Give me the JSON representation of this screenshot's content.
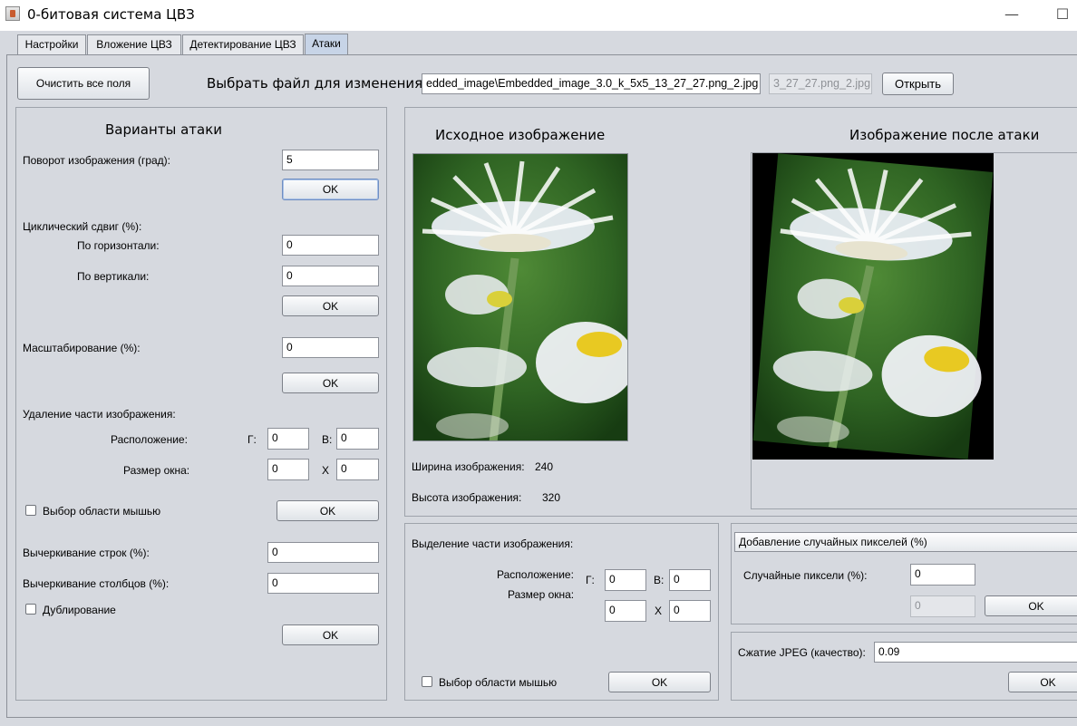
{
  "window": {
    "title": "0-битовая система ЦВЗ",
    "minimize_glyph": "—",
    "maximize_glyph": "☐"
  },
  "tabs": [
    {
      "label": "Настройки"
    },
    {
      "label": "Вложение ЦВЗ"
    },
    {
      "label": "Детектирование ЦВЗ"
    },
    {
      "label": "Атаки"
    }
  ],
  "toolbar": {
    "clear_button": "Очистить все поля",
    "choose_file_label": "Выбрать файл для изменения:",
    "file_path": "edded_image\\Embedded_image_3.0_k_5x5_13_27_27.png_2.jpg",
    "output_name": "3_27_27.png_2.jpg",
    "open_button": "Открыть"
  },
  "attacks": {
    "title": "Варианты атаки",
    "rotation_label": "Поворот изображения (град):",
    "rotation_value": "5",
    "ok": "OK",
    "shift_label": "Циклический сдвиг (%):",
    "shift_h_label": "По горизонтали:",
    "shift_h_value": "0",
    "shift_v_label": "По вертикали:",
    "shift_v_value": "0",
    "scale_label": "Масштабирование (%):",
    "scale_value": "0",
    "remove_label": "Удаление части изображения:",
    "position_label": "Расположение:",
    "g_label": "Г:",
    "g_value": "0",
    "v_label": "В:",
    "v_value": "0",
    "window_size_label": "Размер окна:",
    "size_w_value": "0",
    "x_label": "X",
    "size_h_value": "0",
    "mouse_select_label": "Выбор области мышью",
    "strike_rows_label": "Вычеркивание строк (%):",
    "strike_rows_value": "0",
    "strike_cols_label": "Вычеркивание столбцов (%):",
    "strike_cols_value": "0",
    "duplicate_label": "Дублирование"
  },
  "preview": {
    "original_title": "Исходное изображение",
    "attacked_title": "Изображение после атаки",
    "width_label": "Ширина изображения:",
    "width_value": "240",
    "height_label": "Высота изображения:",
    "height_value": "320"
  },
  "selection": {
    "title": "Выделение части изображения:",
    "position_label": "Расположение:",
    "g_label": "Г:",
    "g_value": "0",
    "v_label": "В:",
    "v_value": "0",
    "window_size_label": "Размер окна:",
    "w_value": "0",
    "x_label": "X",
    "h_value": "0",
    "mouse_select_label": "Выбор области мышью",
    "ok": "OK"
  },
  "random_pixels": {
    "combo_value": "Добавление случайных пикселей (%)",
    "label": "Случайные пиксели (%):",
    "value": "0",
    "disabled_value": "0",
    "ok": "OK"
  },
  "jpeg": {
    "label": "Сжатие JPEG (качество):",
    "value": "0.09",
    "ok": "OK"
  }
}
